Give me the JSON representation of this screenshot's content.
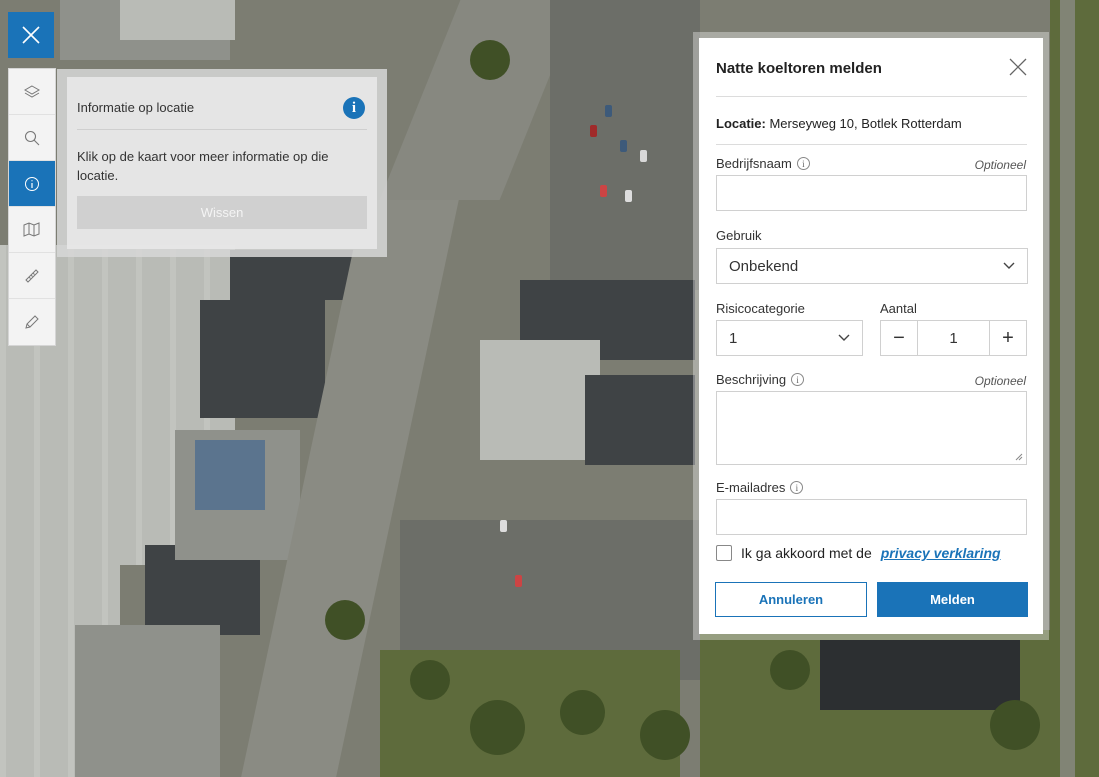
{
  "map": {
    "background_color": "#7c7d72"
  },
  "toolbar": {
    "close_icon": "close-icon",
    "items": [
      {
        "name": "layers",
        "icon": "layers-icon",
        "active": false
      },
      {
        "name": "search",
        "icon": "search-icon",
        "active": false
      },
      {
        "name": "info",
        "icon": "info-icon",
        "active": true
      },
      {
        "name": "map-compare",
        "icon": "map-compare-icon",
        "active": false
      },
      {
        "name": "measure",
        "icon": "ruler-icon",
        "active": false
      },
      {
        "name": "draw",
        "icon": "pencil-icon",
        "active": false
      }
    ],
    "accent_color": "#1a73b8"
  },
  "info_panel": {
    "title": "Informatie op locatie",
    "text": "Klik op de kaart voor meer informatie op die locatie.",
    "clear_button": "Wissen"
  },
  "form": {
    "title": "Natte koeltoren melden",
    "location_label": "Locatie:",
    "location_value": "Merseyweg 10, Botlek Rotterdam",
    "company_label": "Bedrijfsnaam",
    "optional": "Optioneel",
    "company_value": "",
    "usage_label": "Gebruik",
    "usage_value": "Onbekend",
    "risk_label": "Risicocategorie",
    "risk_value": "1",
    "count_label": "Aantal",
    "count_value": "1",
    "count_minus": "−",
    "count_plus": "+",
    "description_label": "Beschrijving",
    "description_value": "",
    "email_label": "E-mailadres",
    "email_value": "",
    "consent_text": "Ik ga akkoord met de",
    "consent_link": "privacy verklaring",
    "consent_checked": false,
    "cancel_button": "Annuleren",
    "submit_button": "Melden"
  }
}
